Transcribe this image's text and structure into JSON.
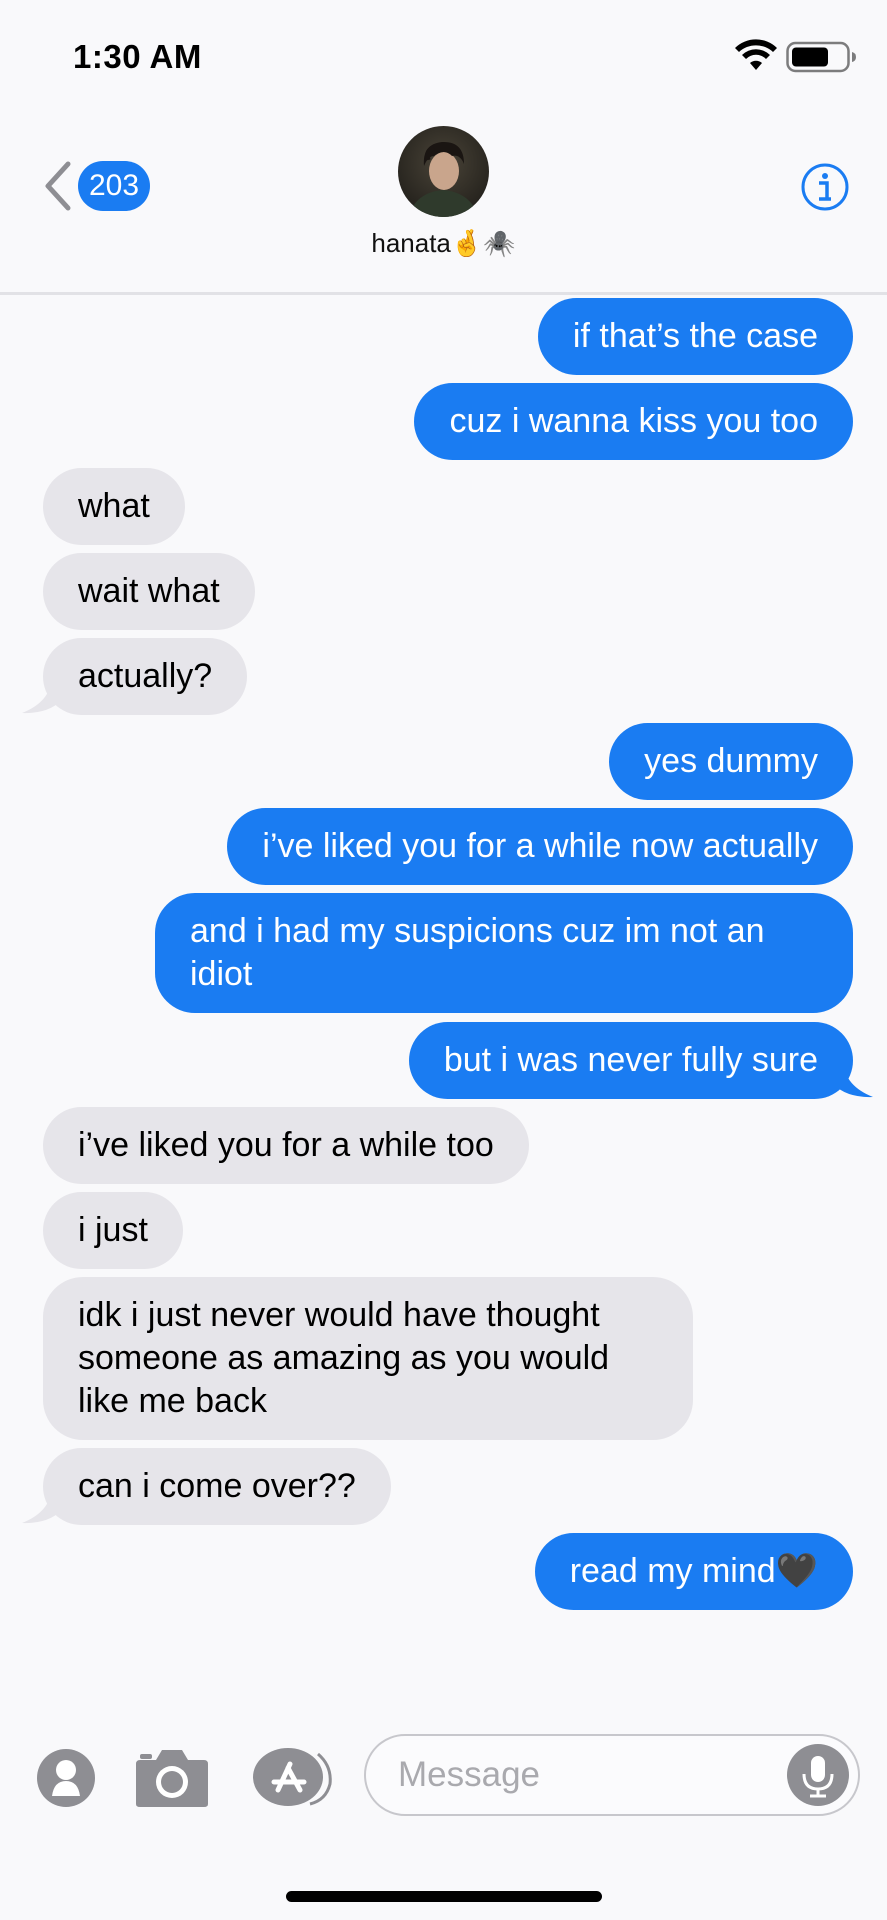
{
  "status_bar": {
    "time": "1:30 AM"
  },
  "header": {
    "back_count": "203",
    "contact_name": "hanata🤞🕷️"
  },
  "messages": [
    {
      "from": "me",
      "text": "if that’s the case"
    },
    {
      "from": "me",
      "text": "cuz i wanna kiss you too"
    },
    {
      "from": "them",
      "text": "what"
    },
    {
      "from": "them",
      "text": "wait what"
    },
    {
      "from": "them",
      "text": "actually?"
    },
    {
      "from": "me",
      "text": "yes dummy"
    },
    {
      "from": "me",
      "text": "i’ve liked you for a while now actually"
    },
    {
      "from": "me",
      "text": "and i had my suspicions cuz im not an idiot"
    },
    {
      "from": "me",
      "text": "but i was never fully sure"
    },
    {
      "from": "them",
      "text": "i’ve liked you for a while too"
    },
    {
      "from": "them",
      "text": "i just"
    },
    {
      "from": "them",
      "text": "idk i just never would have thought someone as amazing as you would like me back"
    },
    {
      "from": "them",
      "text": "can i come over??"
    },
    {
      "from": "me",
      "text": "read my mind🖤"
    }
  ],
  "input": {
    "placeholder": "Message"
  },
  "colors": {
    "sent": "#1a7cf2",
    "received": "#e6e5ea",
    "background": "#f9f9fb"
  },
  "icons": [
    "wifi-icon",
    "battery-icon",
    "back-chevron-icon",
    "info-icon",
    "contacts-icon",
    "camera-icon",
    "app-store-icon",
    "microphone-icon"
  ]
}
